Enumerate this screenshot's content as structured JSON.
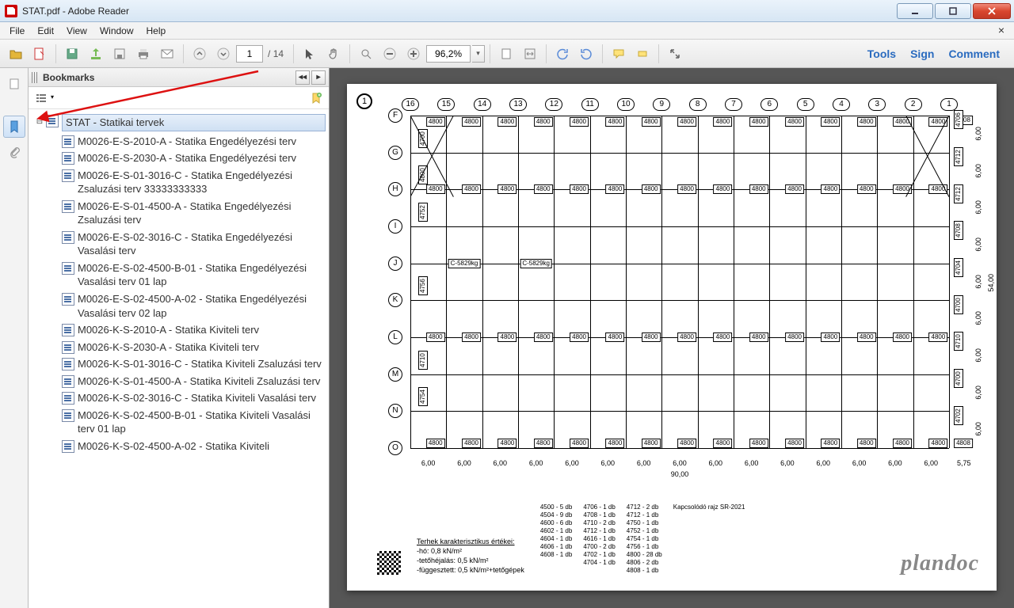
{
  "window": {
    "title": "STAT.pdf - Adobe Reader"
  },
  "menu": {
    "file": "File",
    "edit": "Edit",
    "view": "View",
    "window": "Window",
    "help": "Help"
  },
  "toolbar": {
    "page_current": "1",
    "page_sep": "/",
    "page_total": "14",
    "zoom": "96,2%",
    "links": {
      "tools": "Tools",
      "sign": "Sign",
      "comment": "Comment"
    }
  },
  "bookmarks": {
    "title": "Bookmarks",
    "root": "STAT - Statikai tervek",
    "items": [
      "M0026-E-S-2010-A - Statika Engedélyezési terv",
      "M0026-E-S-2030-A - Statika Engedélyezési terv",
      "M0026-E-S-01-3016-C - Statika Engedélyezési Zsaluzási terv 33333333333",
      "M0026-E-S-01-4500-A - Statika Engedélyezési Zsaluzási terv",
      "M0026-E-S-02-3016-C - Statika Engedélyezési Vasalási terv",
      "M0026-E-S-02-4500-B-01 - Statika Engedélyezési Vasalási terv 01 lap",
      "M0026-E-S-02-4500-A-02 - Statika Engedélyezési Vasalási terv 02 lap",
      "M0026-K-S-2010-A - Statika Kiviteli terv",
      "M0026-K-S-2030-A - Statika Kiviteli terv",
      "M0026-K-S-01-3016-C - Statika Kiviteli Zsaluzási terv",
      "M0026-K-S-01-4500-A - Statika Kiviteli Zsaluzási terv",
      "M0026-K-S-02-3016-C - Statika Kiviteli Vasalási terv",
      "M0026-K-S-02-4500-B-01 - Statika Kiviteli Vasalási terv 01 lap",
      "M0026-K-S-02-4500-A-02 - Statika Kiviteli"
    ]
  },
  "drawing": {
    "page_badge": "1",
    "col_labels": [
      "16",
      "15",
      "14",
      "13",
      "12",
      "11",
      "10",
      "9",
      "8",
      "7",
      "6",
      "5",
      "4",
      "3",
      "2",
      "1"
    ],
    "row_labels": [
      "F",
      "G",
      "H",
      "I",
      "J",
      "K",
      "L",
      "M",
      "N",
      "O"
    ],
    "top_tag_value": "4800",
    "top_edge_value": "4808",
    "row_tag_value": "4800",
    "left_tags": [
      "4700",
      "4800",
      "4752",
      "4756",
      "4710",
      "4754"
    ],
    "beam_label": "C-5829kg",
    "bay_dim": "6,00",
    "total_dim": "90,00",
    "right_dims": [
      "6,00",
      "6,00",
      "6,00",
      "6,00",
      "6,00",
      "6,00",
      "6,00",
      "6,00",
      "6,00"
    ],
    "right_total": "54,00",
    "right_run": "5,75",
    "loads_title": "Terhek karakterisztikus értékei:",
    "loads": [
      "-hó: 0,8 kN/m²",
      "-tetőhéjalás: 0,5 kN/m²",
      "-függesztett: 0,5 kN/m²+tetőgépek"
    ],
    "count_cols": [
      [
        "4500 - 5 db",
        "4504 - 9 db",
        "4600 - 6 db",
        "4602 - 1 db",
        "4604 - 1 db",
        "4606 - 1 db",
        "4608 - 1 db"
      ],
      [
        "4706 - 1 db",
        "4708 - 1 db",
        "4710 - 2 db",
        "4712 - 1 db",
        "4616 - 1 db",
        "4700 - 2 db",
        "4702 - 1 db",
        "4704 - 1 db"
      ],
      [
        "4712 - 2 db",
        "4712 - 1 db",
        "4750 - 1 db",
        "4752 - 1 db",
        "4754 - 1 db",
        "4756 - 1 db",
        "4800 - 28 db",
        "4806 - 2 db",
        "4808 - 1 db"
      ],
      [
        "Kapcsolódó rajz SR-2021"
      ]
    ],
    "brand": "plandoc",
    "right_edge_tags": [
      "4706",
      "4712",
      "4712",
      "4708",
      "4704",
      "4700",
      "4710",
      "4700",
      "4702"
    ],
    "corner_tag": "4808"
  }
}
